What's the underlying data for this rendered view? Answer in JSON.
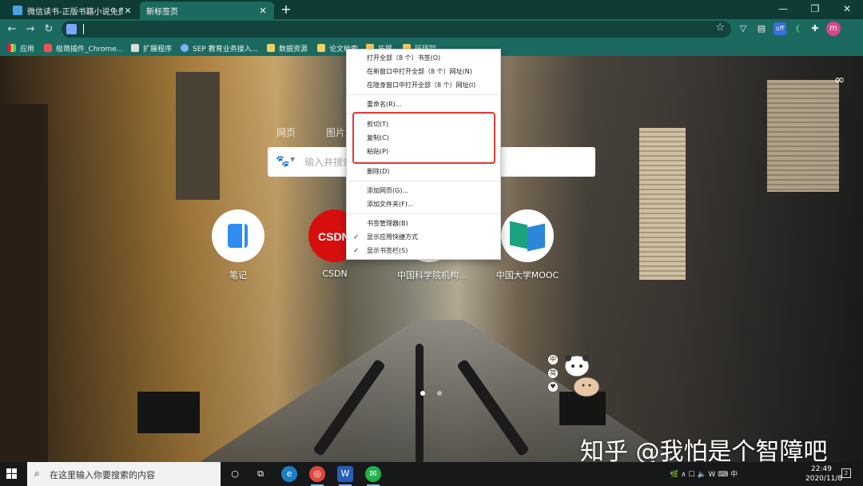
{
  "browser": {
    "tabs": [
      {
        "title": "微信读书-正版书籍小说免费阅读",
        "active": false
      },
      {
        "title": "新标签页",
        "active": true
      }
    ],
    "new_tab_symbol": "+",
    "window_controls": {
      "minimize": "—",
      "restore": "❐",
      "close": "✕"
    },
    "toolbar": {
      "back": "←",
      "forward": "→",
      "reload": "↻",
      "address": "",
      "star": "☆"
    },
    "extensions": [
      "vpn-icon",
      "pdf-icon",
      "off-extension-icon",
      "leaf-icon",
      "puzzle-icon"
    ],
    "extension_badge": "off",
    "profile_initial": "m"
  },
  "bookmarks": [
    {
      "label": "应用",
      "icon": "apps-icon"
    },
    {
      "label": "极简插件_Chrome...",
      "icon": "plugin-site-icon"
    },
    {
      "label": "扩展程序",
      "icon": "puzzle-icon"
    },
    {
      "label": "SEP 教育业务接入...",
      "icon": "sep-icon"
    },
    {
      "label": "数据资源",
      "icon": "folder-icon"
    },
    {
      "label": "论文检索",
      "icon": "folder-icon"
    },
    {
      "label": "拓展",
      "icon": "folder-icon"
    },
    {
      "label": "砥砺院",
      "icon": "folder-icon"
    }
  ],
  "newtab": {
    "search_tabs": [
      "网页",
      "图片"
    ],
    "search_placeholder": "输入并搜索",
    "shortcuts": [
      {
        "label": "笔记",
        "color": "#ffffff"
      },
      {
        "label": "CSDN",
        "color": "#d7100f",
        "logo_text": "CSDN"
      },
      {
        "label": "中国科学院机构...",
        "color": "#ffffff"
      },
      {
        "label": "中国大学MOOC",
        "color": "#ffffff"
      }
    ],
    "infinity_icon": "∞",
    "side_icons": [
      "中",
      "简",
      "♥"
    ]
  },
  "context_menu": {
    "items": [
      {
        "label": "打开全部（8 个）书签(O)"
      },
      {
        "label": "在新窗口中打开全部（8 个）网址(N)"
      },
      {
        "label": "在隐身窗口中打开全部（8 个）网址(I)"
      },
      {
        "label": "重命名(R)..."
      },
      {
        "label": "剪切(T)"
      },
      {
        "label": "复制(C)"
      },
      {
        "label": "粘贴(P)"
      },
      {
        "label": "删除(D)"
      },
      {
        "label": "添加网页(G)..."
      },
      {
        "label": "添加文件夹(F)..."
      },
      {
        "label": "书签管理器(B)"
      },
      {
        "label": "显示应用快捷方式",
        "checked": true
      },
      {
        "label": "显示书签栏(S)",
        "checked": true
      }
    ],
    "check_mark": "✓"
  },
  "watermark": "知乎 @我怕是个智障吧",
  "taskbar": {
    "search_placeholder": "在这里输入你要搜索的内容",
    "pinned": [
      "cortana-icon",
      "task-view-icon",
      "edge-icon",
      "chrome-icon",
      "word-icon",
      "wechat-icon"
    ],
    "tray_icons": "🌿 ∧  ☐  🔈  W  ⌨  中",
    "ime": "中",
    "time": "22:49",
    "date": "2020/11/8",
    "notification_count": "2"
  },
  "colors": {
    "frame": "#0e3b35",
    "toolbar": "#1c6a5f",
    "highlight_box": "#e33b3b",
    "csdn_red": "#d7100f"
  }
}
